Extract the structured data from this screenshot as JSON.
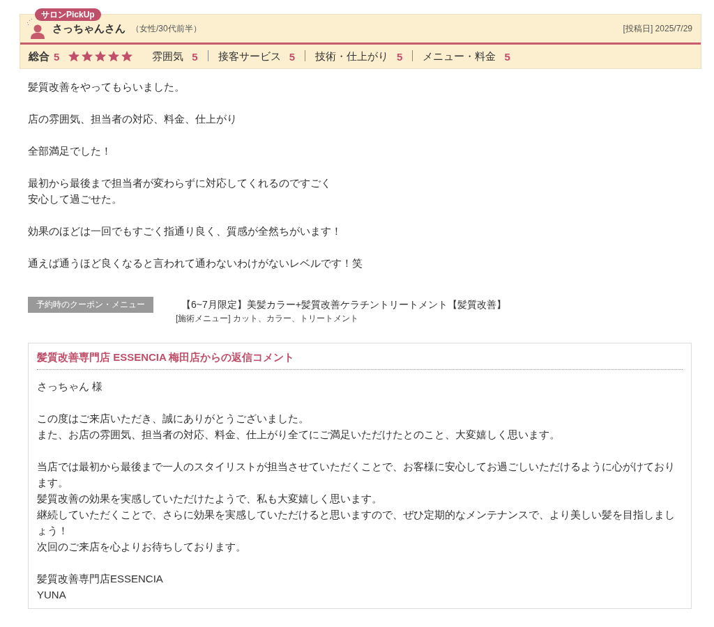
{
  "badge": "サロンPickUp",
  "reviewer": {
    "name": "さっちゃんさん",
    "profile": "（女性/30代前半）",
    "posted": "[投稿日] 2025/7/29"
  },
  "rating": {
    "overall_label": "総合",
    "overall_score": "5",
    "stars": 5,
    "categories": [
      {
        "label": "雰囲気",
        "score": "5"
      },
      {
        "label": "接客サービス",
        "score": "5"
      },
      {
        "label": "技術・仕上がり",
        "score": "5"
      },
      {
        "label": "メニュー・料金",
        "score": "5"
      }
    ]
  },
  "review_paragraphs": [
    [
      "髪質改善をやってもらいました。"
    ],
    [
      "店の雰囲気、担当者の対応、料金、仕上がり"
    ],
    [
      "全部満足でした！"
    ],
    [
      "最初から最後まで担当者が変わらずに対応してくれるのですごく",
      "安心して過ごせた。"
    ],
    [
      "効果のほどは一回でもすごく指通り良く、質感が全然ちがいます！"
    ],
    [
      "通えば通うほど良くなると言われて通わないわけがないレベルです！笑"
    ]
  ],
  "coupon": {
    "label": "予約時のクーポン・メニュー",
    "title": "【6~7月限定】美髪カラー+髪質改善ケラチントリートメント【髪質改善】",
    "menu": "[施術メニュー] カット、カラー、トリートメント"
  },
  "reply": {
    "title": "髪質改善専門店 ESSENCIA 梅田店からの返信コメント",
    "paragraphs": [
      [
        "さっちゃん 様"
      ],
      [
        "この度はご来店いただき、誠にありがとうございました。",
        "また、お店の雰囲気、担当者の対応、料金、仕上がり全てにご満足いただけたとのこと、大変嬉しく思います。"
      ],
      [
        "当店では最初から最後まで一人のスタイリストが担当させていただくことで、お客様に安心してお過ごしいただけるように心がけております。",
        "髪質改善の効果を実感していただけたようで、私も大変嬉しく思います。",
        "継続していただくことで、さらに効果を実感していただけると思いますので、ぜひ定期的なメンテナンスで、より美しい髪を目指しましょう！",
        "次回のご来店を心よりお待ちしております。"
      ],
      [
        "髪質改善専門店ESSENCIA",
        "YUNA"
      ]
    ]
  }
}
